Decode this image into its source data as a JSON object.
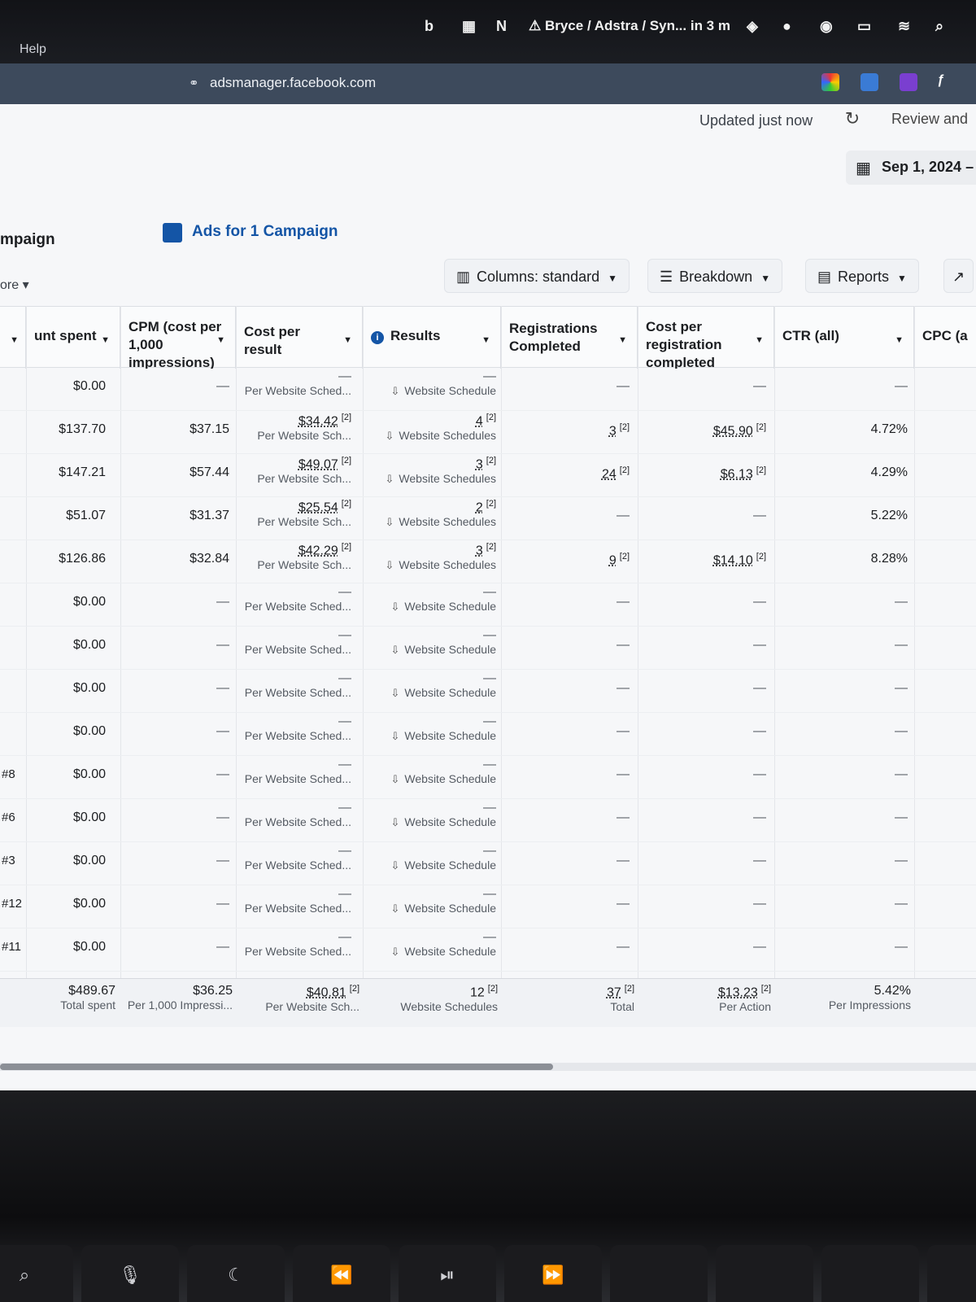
{
  "menubar": {
    "help": "Help",
    "event": "⚠ Bryce / Adstra / Syn... in 3 m"
  },
  "browser": {
    "url": "adsmanager.facebook.com"
  },
  "header": {
    "updated": "Updated just now",
    "review": "Review and",
    "date": "Sep 1, 2024 –"
  },
  "nav": {
    "campaign": "mpaign",
    "ads_title": "Ads for 1 Campaign",
    "more": "ore"
  },
  "toolbar": {
    "columns": "Columns: standard",
    "breakdown": "Breakdown",
    "reports": "Reports"
  },
  "columns": {
    "amount_spent": "unt spent",
    "cpm": "CPM (cost per 1,000 impressions)",
    "cost_per_result": "Cost per result",
    "results": "Results",
    "registrations": "Registrations Completed",
    "cost_per_registration": "Cost per registration completed",
    "ctr": "CTR (all)",
    "cpc": "CPC (a"
  },
  "rows": [
    {
      "name": "",
      "spent": "$0.00",
      "cpm": "—",
      "cpr": "—",
      "cpr_sub": "Per Website Sched...",
      "results": "—",
      "results_sub": "Website Schedule",
      "reg": "—",
      "cpreg": "—",
      "ctr": "—"
    },
    {
      "name": "",
      "spent": "$137.70",
      "cpm": "$37.15",
      "cpr": "$34.42",
      "cpr_sub": "Per Website Sch...",
      "results": "4",
      "results_sub": "Website Schedules",
      "reg": "3",
      "cpreg": "$45.90",
      "ctr": "4.72%"
    },
    {
      "name": "",
      "spent": "$147.21",
      "cpm": "$57.44",
      "cpr": "$49.07",
      "cpr_sub": "Per Website Sch...",
      "results": "3",
      "results_sub": "Website Schedules",
      "reg": "24",
      "cpreg": "$6.13",
      "ctr": "4.29%"
    },
    {
      "name": "",
      "spent": "$51.07",
      "cpm": "$31.37",
      "cpr": "$25.54",
      "cpr_sub": "Per Website Sch...",
      "results": "2",
      "results_sub": "Website Schedules",
      "reg": "—",
      "cpreg": "—",
      "ctr": "5.22%"
    },
    {
      "name": "",
      "spent": "$126.86",
      "cpm": "$32.84",
      "cpr": "$42.29",
      "cpr_sub": "Per Website Sch...",
      "results": "3",
      "results_sub": "Website Schedules",
      "reg": "9",
      "cpreg": "$14.10",
      "ctr": "8.28%"
    },
    {
      "name": "",
      "spent": "$0.00",
      "cpm": "—",
      "cpr": "—",
      "cpr_sub": "Per Website Sched...",
      "results": "—",
      "results_sub": "Website Schedule",
      "reg": "—",
      "cpreg": "—",
      "ctr": "—"
    },
    {
      "name": "",
      "spent": "$0.00",
      "cpm": "—",
      "cpr": "—",
      "cpr_sub": "Per Website Sched...",
      "results": "—",
      "results_sub": "Website Schedule",
      "reg": "—",
      "cpreg": "—",
      "ctr": "—"
    },
    {
      "name": "",
      "spent": "$0.00",
      "cpm": "—",
      "cpr": "—",
      "cpr_sub": "Per Website Sched...",
      "results": "—",
      "results_sub": "Website Schedule",
      "reg": "—",
      "cpreg": "—",
      "ctr": "—"
    },
    {
      "name": "",
      "spent": "$0.00",
      "cpm": "—",
      "cpr": "—",
      "cpr_sub": "Per Website Sched...",
      "results": "—",
      "results_sub": "Website Schedule",
      "reg": "—",
      "cpreg": "—",
      "ctr": "—"
    },
    {
      "name": "#8",
      "spent": "$0.00",
      "cpm": "—",
      "cpr": "—",
      "cpr_sub": "Per Website Sched...",
      "results": "—",
      "results_sub": "Website Schedule",
      "reg": "—",
      "cpreg": "—",
      "ctr": "—"
    },
    {
      "name": "#6",
      "spent": "$0.00",
      "cpm": "—",
      "cpr": "—",
      "cpr_sub": "Per Website Sched...",
      "results": "—",
      "results_sub": "Website Schedule",
      "reg": "—",
      "cpreg": "—",
      "ctr": "—"
    },
    {
      "name": "#3",
      "spent": "$0.00",
      "cpm": "—",
      "cpr": "—",
      "cpr_sub": "Per Website Sched...",
      "results": "—",
      "results_sub": "Website Schedule",
      "reg": "—",
      "cpreg": "—",
      "ctr": "—"
    },
    {
      "name": "#12",
      "spent": "$0.00",
      "cpm": "—",
      "cpr": "—",
      "cpr_sub": "Per Website Sched...",
      "results": "—",
      "results_sub": "Website Schedule",
      "reg": "—",
      "cpreg": "—",
      "ctr": "—"
    },
    {
      "name": "#11",
      "spent": "$0.00",
      "cpm": "—",
      "cpr": "—",
      "cpr_sub": "Per Website Sched...",
      "results": "—",
      "results_sub": "Website Schedule",
      "reg": "—",
      "cpreg": "—",
      "ctr": "—"
    }
  ],
  "footnote_mark": "[2]",
  "totals": {
    "spent": "$489.67",
    "spent_sub": "Total spent",
    "cpm": "$36.25",
    "cpm_sub": "Per 1,000 Impressi...",
    "cpr": "$40.81",
    "cpr_sub": "Per Website Sch...",
    "results": "12",
    "results_sub": "Website Schedules",
    "reg": "37",
    "reg_sub": "Total",
    "cpreg": "$13.23",
    "cpreg_sub": "Per Action",
    "ctr": "5.42%",
    "ctr_sub": "Per Impressions"
  },
  "keyboard": {
    "moon": "☾",
    "rewind": "⏪",
    "playpause": "⏯",
    "ff": "⏩"
  }
}
